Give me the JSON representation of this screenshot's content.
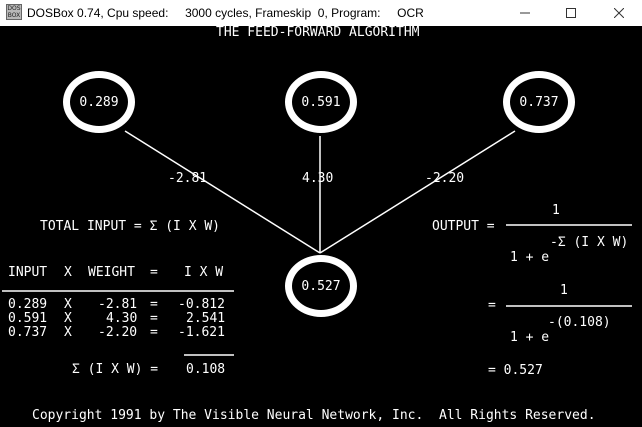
{
  "window": {
    "title": "DOSBox 0.74, Cpu speed:     3000 cycles, Frameskip  0, Program:     OCR",
    "icon_text_top": "DOS",
    "icon_text_bottom": "BOX",
    "minimize_icon": "minimize-icon",
    "maximize_icon": "maximize-icon",
    "close_icon": "close-icon"
  },
  "screen": {
    "heading": "THE FEED-FORWARD ALGORITHM",
    "inputs": [
      "0.289",
      "0.591",
      "0.737"
    ],
    "weights": [
      "-2.81",
      "4.30",
      "-2.20"
    ],
    "output_node": "0.527",
    "total_input_formula": "TOTAL INPUT = Σ (I X W)",
    "output_label": "OUTPUT =",
    "output_num": "1",
    "output_den_base": "1 + e",
    "output_exponent_formula": "-Σ (I X W)",
    "eq2_sign": "=",
    "eq2_num": "1",
    "eq2_den_base": "1 + e",
    "eq2_exponent": "-(0.108)",
    "final_result": "= 0.527",
    "table": {
      "headers": [
        "INPUT",
        "X",
        "WEIGHT",
        "=",
        "I X W"
      ],
      "rows": [
        [
          "0.289",
          "X",
          "-2.81",
          "=",
          "-0.812"
        ],
        [
          "0.591",
          "X",
          "4.30",
          "=",
          "2.541"
        ],
        [
          "0.737",
          "X",
          "-2.20",
          "=",
          "-1.621"
        ]
      ],
      "sum_label": "Σ (I X W) =",
      "sum_value": "0.108"
    },
    "copyright": "Copyright 1991 by The Visible Neural Network, Inc.  All Rights Reserved."
  }
}
